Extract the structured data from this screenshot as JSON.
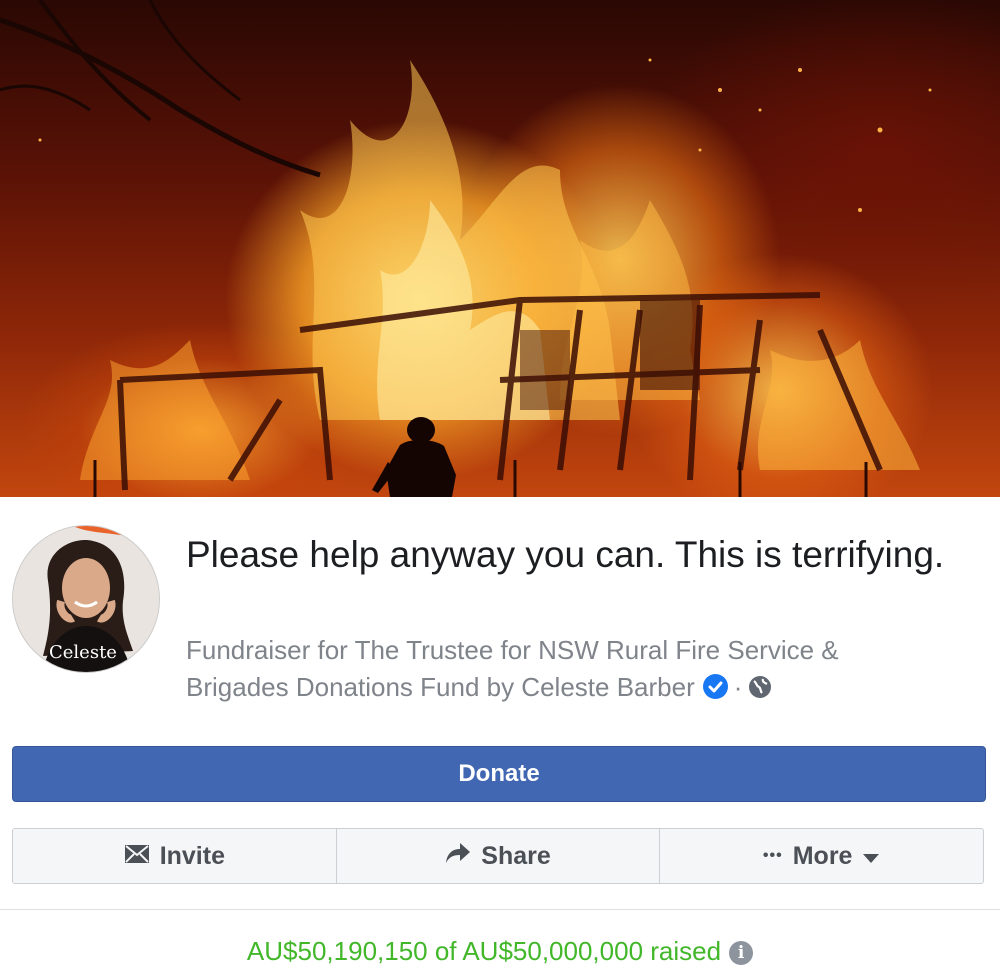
{
  "fundraiser": {
    "title": "Please help anyway you can. This is terrifying.",
    "subtitle_prefix": "Fundraiser for The Trustee for NSW Rural Fire Service & Brigades Donations Fund by Celeste Barber",
    "separator": "·",
    "avatar_text": "Celeste",
    "verified_icon": "verified-badge-icon",
    "privacy_icon": "globe-icon"
  },
  "buttons": {
    "donate": "Donate",
    "invite": "Invite",
    "share": "Share",
    "more_dots": "•••",
    "more": "More"
  },
  "progress": {
    "raised_text": "AU$50,190,150 of AU$50,000,000 raised",
    "raised_amount": 50190150,
    "goal_amount": 50000000
  },
  "colors": {
    "donate_bg": "#4267b2",
    "raised_text": "#42b72a",
    "verified": "#1877f2"
  }
}
